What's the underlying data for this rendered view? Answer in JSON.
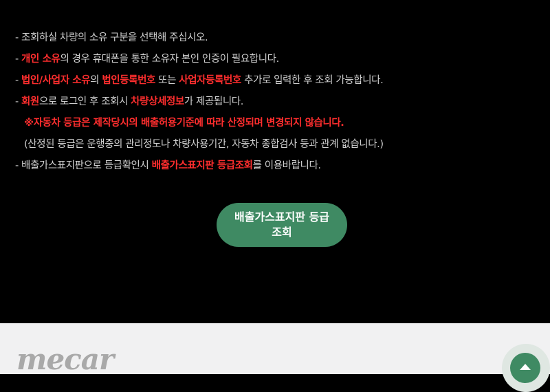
{
  "notice": {
    "line1": {
      "t1": "- 조회하실 차량의 소유 구분을 선택해 주십시오."
    },
    "line2": {
      "t1": "- ",
      "h1": "개인 소유",
      "t2": "의 경우 휴대폰을 통한 소유자 본인 인증이 필요합니다."
    },
    "line3": {
      "t1": "- ",
      "h1": "법인/사업자 소유",
      "t2": "의 ",
      "h2": "법인등록번호",
      "t3": " 또는 ",
      "h3": "사업자등록번호",
      "t4": " 추가로 입력한 후 조회 가능합니다."
    },
    "line4": {
      "t1": "- ",
      "h1": "회원",
      "t2": "으로 로그인 후 조회시 ",
      "h2": "차량상세정보",
      "t3": "가 제공됩니다."
    },
    "line5": {
      "t1": "※자동차 등급은 제작당시의 배출허용기준에 따라 산정되며 변경되지 않습니다."
    },
    "line6": {
      "t1": "(산정된 등급은 운행중의 관리정도나 차량사용기간, 자동차 종합검사 등과 관계 없습니다.)"
    },
    "line7": {
      "t1": "- 배출가스표지판으로 등급확인시 ",
      "h1": "배출가스표지판 등급조회",
      "t2": "를 이용바랍니다."
    }
  },
  "cta": {
    "label": "배출가스표지판 등급\n조회"
  },
  "footer": {
    "logo_text": "mecar"
  },
  "icons": {
    "scroll_top": "caret-up-icon"
  },
  "colors": {
    "background": "#000000",
    "text": "#cfcfcf",
    "highlight": "#ff2e2e",
    "accent_green": "#3f8a63",
    "footer_bg": "#f1f1f2"
  }
}
